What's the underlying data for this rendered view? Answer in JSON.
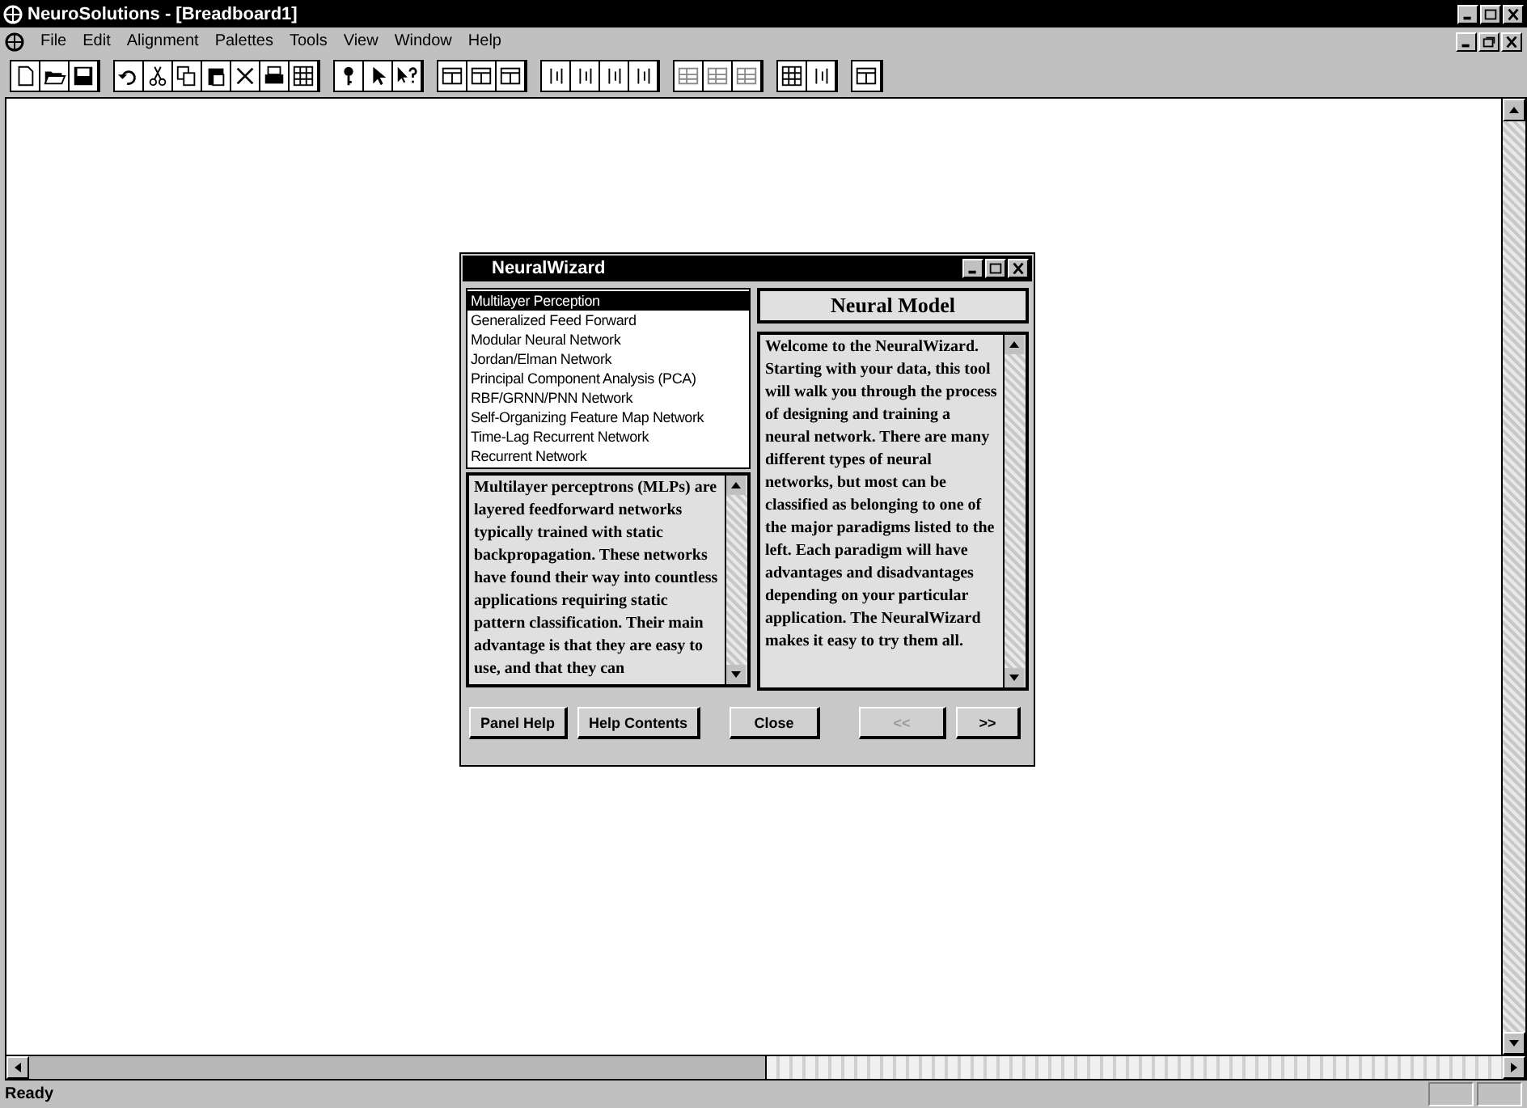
{
  "window": {
    "title": "NeuroSolutions - [Breadboard1]"
  },
  "menu": [
    "File",
    "Edit",
    "Alignment",
    "Palettes",
    "Tools",
    "View",
    "Window",
    "Help"
  ],
  "dialog": {
    "title": "NeuralWizard",
    "models": [
      {
        "label": "Multilayer Perception",
        "selected": true
      },
      {
        "label": "Generalized Feed Forward",
        "selected": false
      },
      {
        "label": "Modular Neural Network",
        "selected": false
      },
      {
        "label": "Jordan/Elman Network",
        "selected": false
      },
      {
        "label": "Principal Component Analysis (PCA)",
        "selected": false
      },
      {
        "label": "RBF/GRNN/PNN Network",
        "selected": false
      },
      {
        "label": "Self-Organizing Feature Map Network",
        "selected": false
      },
      {
        "label": "Time-Lag Recurrent Network",
        "selected": false
      },
      {
        "label": "Recurrent Network",
        "selected": false
      }
    ],
    "description": "Multilayer perceptrons (MLPs) are layered feedforward networks typically trained with static backpropagation. These networks have found their way into countless applications requiring static pattern classification. Their main advantage is that they are easy to use, and that they can",
    "panel_title": "Neural Model",
    "welcome": "Welcome to the NeuralWizard. Starting with your data, this tool will walk you through the process of designing and training a neural network. There are many different types of neural networks, but most can be classified as belonging to one of the major paradigms listed to the left. Each paradigm will have advantages and disadvantages depending on your particular application. The NeuralWizard makes it easy to try them all.",
    "buttons": [
      {
        "label": "Panel Help",
        "disabled": false
      },
      {
        "label": "Help Contents",
        "disabled": false
      },
      {
        "label": "Close",
        "disabled": false
      },
      {
        "label": "<<",
        "disabled": true
      },
      {
        "label": ">>",
        "disabled": false
      }
    ]
  },
  "status_bar": "Ready"
}
